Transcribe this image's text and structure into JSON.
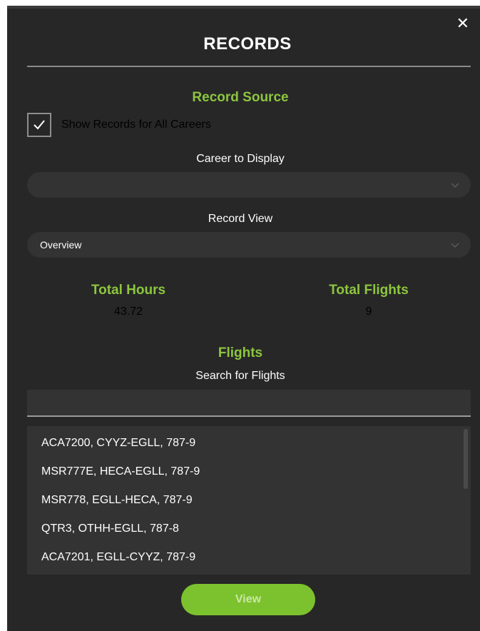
{
  "window": {
    "title": "RECORDS",
    "close_glyph": "✕"
  },
  "record_source": {
    "heading": "Record Source",
    "show_all_label": "Show Records for All Careers",
    "show_all_checked": true,
    "career_label": "Career to Display",
    "career_value": "",
    "view_label": "Record View",
    "view_value": "Overview"
  },
  "stats": {
    "total_hours_label": "Total Hours",
    "total_hours_value": "43.72",
    "total_flights_label": "Total Flights",
    "total_flights_value": "9"
  },
  "flights": {
    "heading": "Flights",
    "search_label": "Search for Flights",
    "search_value": "",
    "items": [
      "ACA7200, CYYZ-EGLL, 787-9",
      "MSR777E, HECA-EGLL, 787-9",
      "MSR778, EGLL-HECA, 787-9",
      "QTR3, OTHH-EGLL, 787-8",
      "ACA7201, EGLL-CYYZ, 787-9"
    ]
  },
  "actions": {
    "view_label": "View"
  },
  "colors": {
    "accent": "#8cc63f",
    "button": "#7cc22e",
    "panel": "#272727",
    "field": "#333333"
  },
  "icons": {
    "close": "close-icon",
    "check": "checkmark-icon",
    "dropdown": "chevron-down-icon"
  }
}
